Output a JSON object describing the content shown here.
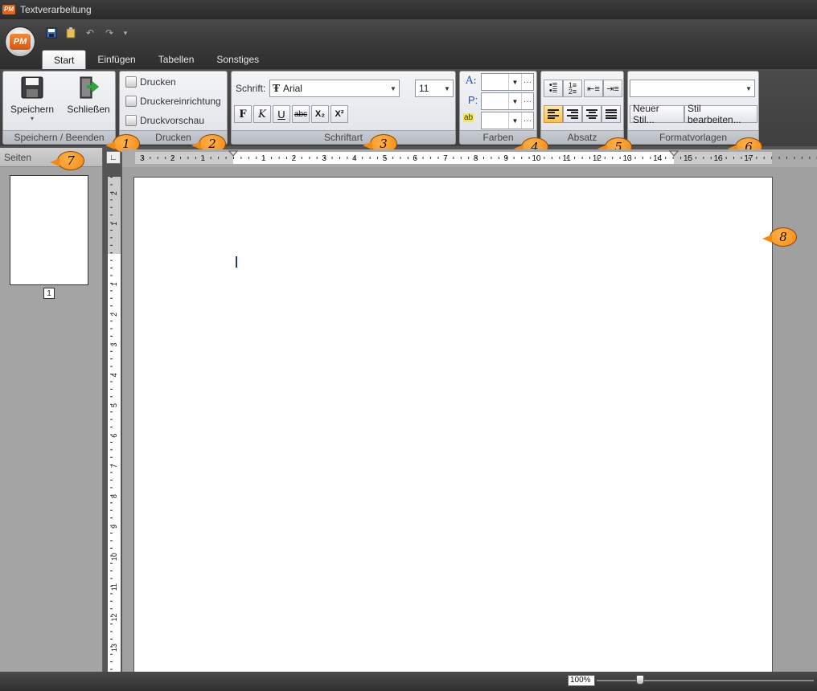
{
  "window": {
    "title": "Textverarbeitung",
    "logo": "PM"
  },
  "tabs": [
    {
      "label": "Start",
      "active": true
    },
    {
      "label": "Einfügen",
      "active": false
    },
    {
      "label": "Tabellen",
      "active": false
    },
    {
      "label": "Sonstiges",
      "active": false
    }
  ],
  "groups": {
    "save": {
      "label": "Speichern / Beenden",
      "save": "Speichern",
      "close": "Schließen"
    },
    "print": {
      "label": "Drucken",
      "print": "Drucken",
      "setup": "Druckereinrichtung",
      "preview": "Druckvorschau"
    },
    "font": {
      "label": "Schriftart",
      "font_label": "Schrift:",
      "font_name": "Arial",
      "font_size": "11",
      "bold": "F",
      "italic": "K",
      "underline": "U",
      "strike": "abc",
      "sub": "X₂",
      "sup": "X²"
    },
    "colors": {
      "label": "Farben",
      "text_color_label": "A:",
      "para_color_label": "P:",
      "highlight_label": "ab"
    },
    "paragraph": {
      "label": "Absatz"
    },
    "styles": {
      "label": "Formatvorlagen",
      "new_style": "Neuer Stil...",
      "edit_style": "Stil bearbeiten...",
      "style_value": ""
    }
  },
  "callouts": [
    "1",
    "2",
    "3",
    "4",
    "5",
    "6",
    "7",
    "8"
  ],
  "pages_pane": {
    "header": "Seiten",
    "page_number": "1"
  },
  "ruler": {
    "h_labels": [
      "3",
      "2",
      "1",
      "1",
      "2",
      "3",
      "4",
      "5",
      "6",
      "7",
      "8",
      "9",
      "10",
      "11",
      "12",
      "13",
      "14",
      "15",
      "16",
      "17"
    ],
    "v_labels": [
      "2",
      "1",
      "1",
      "2",
      "3",
      "4",
      "5",
      "6",
      "7",
      "8",
      "9",
      "10",
      "11",
      "12",
      "13"
    ]
  },
  "status": {
    "zoom": "100%",
    "zoom_percent": 100
  }
}
